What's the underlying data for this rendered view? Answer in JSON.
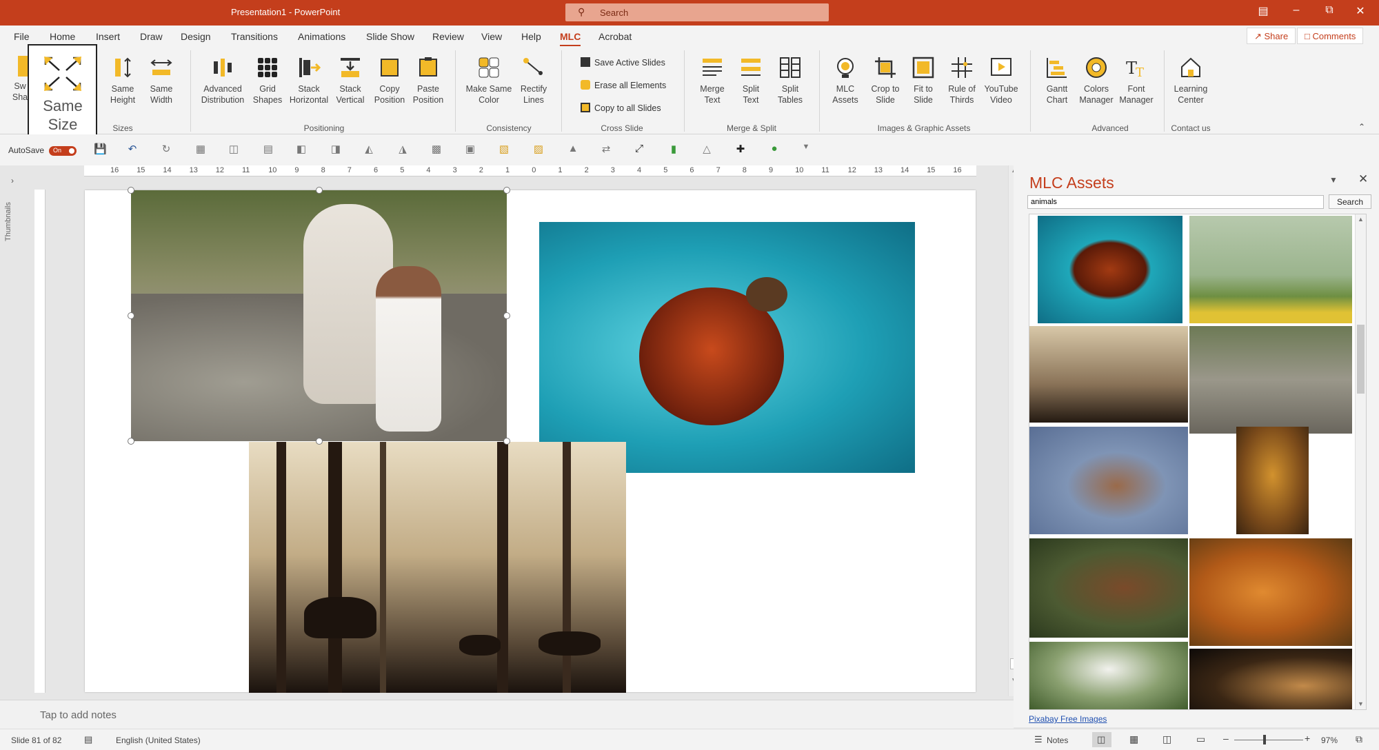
{
  "window": {
    "title": "Presentation1 - PowerPoint",
    "search_placeholder": "Search"
  },
  "tabs": [
    "File",
    "Home",
    "Insert",
    "Draw",
    "Design",
    "Transitions",
    "Animations",
    "Slide Show",
    "Review",
    "View",
    "Help",
    "MLC",
    "Acrobat"
  ],
  "active_tab": "MLC",
  "share_label": "Share",
  "comments_label": "Comments",
  "ribbon": {
    "same_size": "Same Size",
    "same_height": "Same Height",
    "same_width": "Same Width",
    "sizes_group": "Sizes",
    "advanced_distribution": "Advanced Distribution",
    "grid_shapes": "Grid Shapes",
    "stack_horizontal": "Stack Horizontal",
    "stack_vertical": "Stack Vertical",
    "copy_position": "Copy Position",
    "paste_position": "Paste Position",
    "positioning_group": "Positioning",
    "make_same_color": "Make Same Color",
    "rectify_lines": "Rectify Lines",
    "consistency_group": "Consistency",
    "save_active_slides": "Save Active Slides",
    "erase_all_elements": "Erase all Elements",
    "copy_to_all_slides": "Copy to all Slides",
    "cross_slide_group": "Cross Slide",
    "merge_text": "Merge Text",
    "split_text": "Split Text",
    "split_tables": "Split Tables",
    "merge_split_group": "Merge & Split",
    "mlc_assets": "MLC Assets",
    "crop_to_slide": "Crop to Slide",
    "fit_to_slide": "Fit to Slide",
    "rule_of_thirds": "Rule of Thirds",
    "youtube_video": "YouTube Video",
    "images_group": "Images & Graphic Assets",
    "gantt_chart": "Gantt Chart",
    "colors_manager": "Colors Manager",
    "font_manager": "Font Manager",
    "advanced_group": "Advanced",
    "learning_center": "Learning Center",
    "contact_group": "Contact us",
    "sw_partial": "Sw",
    "sha_partial": "Sha"
  },
  "qat": {
    "autosave_label": "AutoSave",
    "toggle_label": "On"
  },
  "ruler_labels": [
    "16",
    "15",
    "14",
    "13",
    "12",
    "11",
    "10",
    "9",
    "8",
    "7",
    "6",
    "5",
    "4",
    "3",
    "2",
    "1",
    "0",
    "1",
    "2",
    "3",
    "4",
    "5",
    "6",
    "7",
    "8",
    "9",
    "10",
    "11",
    "12",
    "13",
    "14",
    "15",
    "16"
  ],
  "thumbnails_label": "Thumbnails",
  "notes_placeholder": "Tap to add notes",
  "pane": {
    "title": "MLC Assets",
    "search_value": "animals",
    "search_button": "Search",
    "link": "Pixabay Free Images"
  },
  "status": {
    "slide": "Slide 81 of 82",
    "language": "English (United States)",
    "notes": "Notes",
    "zoom": "97%"
  },
  "colors": {
    "accent": "#c43e1c"
  }
}
